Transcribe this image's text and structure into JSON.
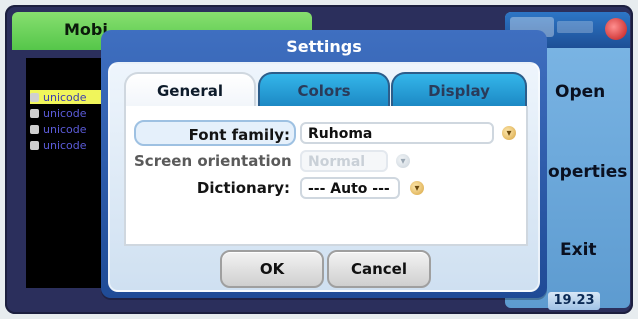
{
  "app": {
    "title": "Mobi"
  },
  "background_list": {
    "items": [
      {
        "label": "unicode",
        "selected": true
      },
      {
        "label": "unicode",
        "selected": false
      },
      {
        "label": "unicode",
        "selected": false
      },
      {
        "label": "unicode",
        "selected": false
      }
    ]
  },
  "dialog": {
    "title": "Settings",
    "tabs": [
      {
        "label": "General",
        "active": true
      },
      {
        "label": "Colors",
        "active": false
      },
      {
        "label": "Display",
        "active": false
      }
    ],
    "fields": {
      "font_family": {
        "label": "Font family:",
        "value": "Ruhoma",
        "dropdown_icon": "chevron-down"
      },
      "screen_orientation": {
        "label": "Screen orientation",
        "value": "Normal",
        "disabled": true,
        "dropdown_icon": "chevron-down"
      },
      "dictionary": {
        "label": "Dictionary:",
        "value": "--- Auto ---",
        "dropdown_icon": "chevron-down"
      }
    },
    "buttons": {
      "ok": "OK",
      "cancel": "Cancel"
    }
  },
  "softkeys": {
    "open": "Open",
    "properties": "operties",
    "exit": "Exit"
  },
  "status": {
    "time": "19.23",
    "icons": [
      "signal-icon",
      "battery-icon",
      "alert-icon"
    ]
  },
  "colors": {
    "app_header_green": "#55c64a",
    "dialog_blue": "#1f4b96",
    "tab_inactive_blue": "#1b86c2",
    "list_selection_yellow": "#f0f55b"
  }
}
